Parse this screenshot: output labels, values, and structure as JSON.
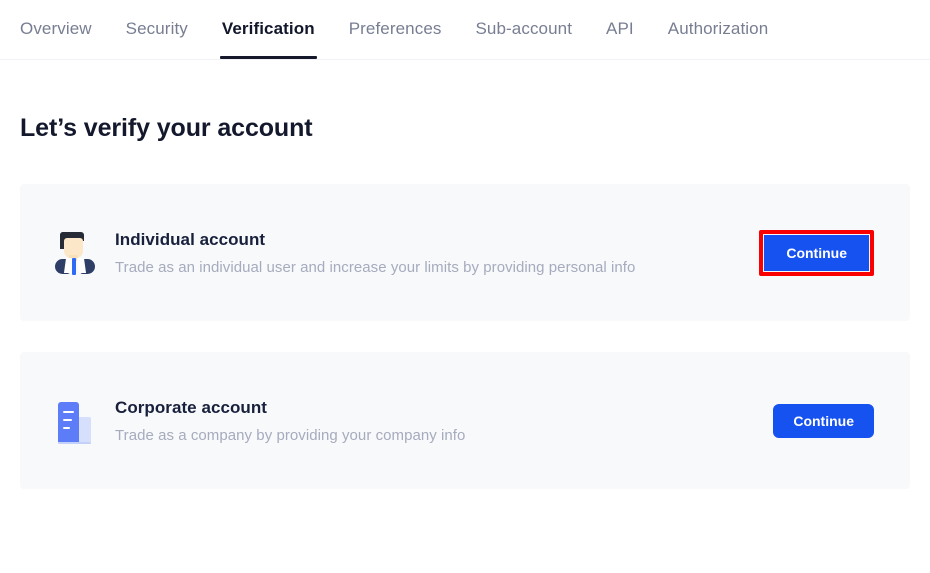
{
  "nav": {
    "tabs": [
      {
        "label": "Overview",
        "active": false
      },
      {
        "label": "Security",
        "active": false
      },
      {
        "label": "Verification",
        "active": true
      },
      {
        "label": "Preferences",
        "active": false
      },
      {
        "label": "Sub-account",
        "active": false
      },
      {
        "label": "API",
        "active": false
      },
      {
        "label": "Authorization",
        "active": false
      }
    ]
  },
  "page": {
    "title": "Let’s verify your account"
  },
  "cards": [
    {
      "icon": "person-icon",
      "title": "Individual account",
      "description": "Trade as an individual user and increase your limits by providing personal info",
      "button_label": "Continue",
      "highlighted": true
    },
    {
      "icon": "building-icon",
      "title": "Corporate account",
      "description": "Trade as a company by providing your company info",
      "button_label": "Continue",
      "highlighted": false
    }
  ],
  "colors": {
    "accent_blue": "#1652f0",
    "highlight_red": "#fa0000",
    "card_background": "#f8f9fb",
    "title_text": "#14182c",
    "muted_text": "#a6abbd",
    "tab_inactive": "#787e92"
  }
}
